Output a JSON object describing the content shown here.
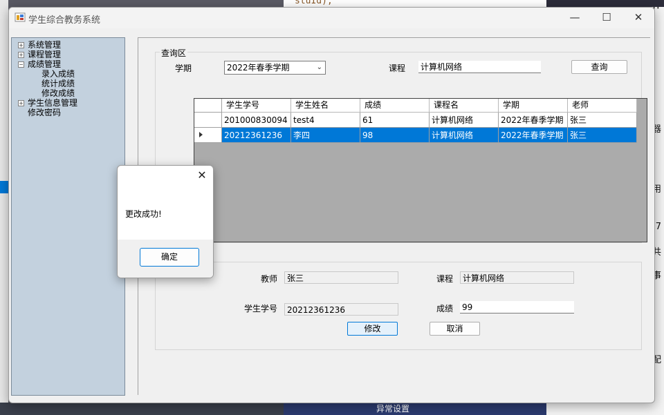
{
  "background": {
    "code_snippet": "stuId);",
    "right_texts": [
      "事件",
      "器",
      "使用",
      "7",
      "共",
      "事",
      "配"
    ],
    "bottom_text": "异常设置"
  },
  "window": {
    "title": "学生综合教务系统",
    "minimize_glyph": "—",
    "maximize_glyph": "☐",
    "close_glyph": "✕"
  },
  "tree": {
    "nodes": [
      {
        "label": "系统管理",
        "expander": "+"
      },
      {
        "label": "课程管理",
        "expander": "+"
      },
      {
        "label": "成绩管理",
        "expander": "−"
      },
      {
        "label": "录入成绩"
      },
      {
        "label": "统计成绩"
      },
      {
        "label": "修改成绩"
      },
      {
        "label": "学生信息管理",
        "expander": "+"
      },
      {
        "label": "修改密码"
      }
    ]
  },
  "query": {
    "group_title": "查询区",
    "term_label": "学期",
    "term_value": "2022年春季学期",
    "course_label": "课程",
    "course_value": "计算机网络",
    "search_button": "查询"
  },
  "grid": {
    "columns": [
      "学生学号",
      "学生姓名",
      "成绩",
      "课程名",
      "学期",
      "老师"
    ],
    "rows": [
      [
        "201000830094",
        "test4",
        "61",
        "计算机网络",
        "2022年春季学期",
        "张三"
      ],
      [
        "20212361236",
        "李四",
        "98",
        "计算机网络",
        "2022年春季学期",
        "张三"
      ]
    ],
    "selected_row": 1
  },
  "edit": {
    "teacher_label": "教师",
    "teacher_value": "张三",
    "course_label": "课程",
    "course_value": "计算机网络",
    "student_id_label": "学生学号",
    "student_id_value": "20212361236",
    "score_label": "成绩",
    "score_value": "99",
    "modify_button": "修改",
    "cancel_button": "取消"
  },
  "dialog": {
    "message": "更改成功!",
    "ok_button": "确定",
    "close_glyph": "✕"
  },
  "colors": {
    "selection": "#0078d7",
    "tree_bg": "#c3d1de",
    "grid_bg": "#ababab"
  }
}
